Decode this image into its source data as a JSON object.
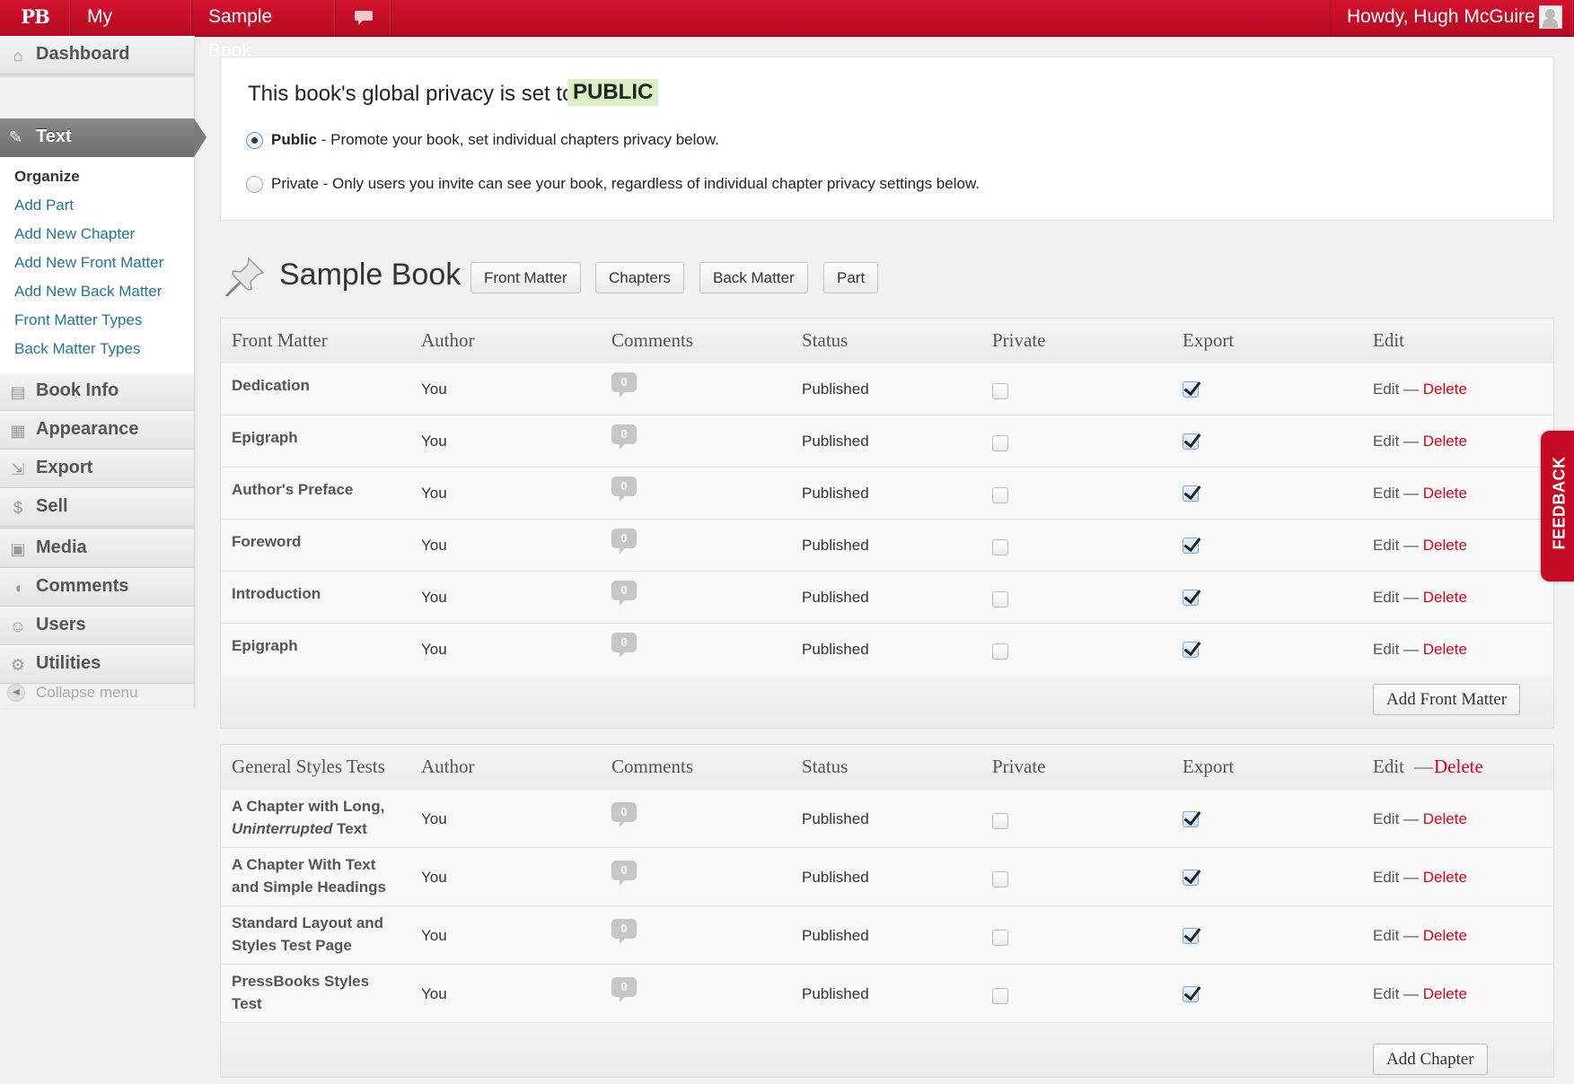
{
  "adminbar": {
    "logo": "PB",
    "catalog": "My Catalog",
    "book": "Sample Book",
    "comments_icon": "speech-bubble-icon",
    "howdy": "Howdy, Hugh McGuire"
  },
  "sidebar": {
    "dashboard": "Dashboard",
    "text": "Text",
    "submenu": [
      "Organize",
      "Add Part",
      "Add New Chapter",
      "Add New Front Matter",
      "Add New Back Matter",
      "Front Matter Types",
      "Back Matter Types"
    ],
    "book_info": "Book Info",
    "appearance": "Appearance",
    "export": "Export",
    "sell": "Sell",
    "media": "Media",
    "comments": "Comments",
    "users": "Users",
    "utilities": "Utilities",
    "collapse": "Collapse menu"
  },
  "privacy": {
    "title": "This book's global privacy is set to",
    "status": "PUBLIC",
    "public_label": "Public",
    "public_desc": " - Promote your book, set individual chapters privacy below.",
    "private_desc": "Private - Only users you invite can see your book, regardless of individual chapter privacy settings below.",
    "selected": "public"
  },
  "heading": {
    "title": "Sample Book",
    "buttons": [
      "Front Matter",
      "Chapters",
      "Back Matter",
      "Part"
    ]
  },
  "front_matter": {
    "headers": [
      "Front Matter",
      "Author",
      "Comments",
      "Status",
      "Private",
      "Export",
      "Edit"
    ],
    "rows": [
      {
        "title": "Dedication",
        "author": "You",
        "comments": "0",
        "status": "Published",
        "private": false,
        "export": true
      },
      {
        "title": "Epigraph",
        "author": "You",
        "comments": "0",
        "status": "Published",
        "private": false,
        "export": true
      },
      {
        "title": "Author's Preface",
        "author": "You",
        "comments": "0",
        "status": "Published",
        "private": false,
        "export": true
      },
      {
        "title": "Foreword",
        "author": "You",
        "comments": "0",
        "status": "Published",
        "private": false,
        "export": true
      },
      {
        "title": "Introduction",
        "author": "You",
        "comments": "0",
        "status": "Published",
        "private": false,
        "export": true
      },
      {
        "title": "Epigraph",
        "author": "You",
        "comments": "0",
        "status": "Published",
        "private": false,
        "export": true
      }
    ],
    "edit_label": "Edit",
    "dash": "—",
    "delete_label": "Delete",
    "add_button": "Add Front Matter"
  },
  "part": {
    "headers": [
      "General Styles Tests",
      "Author",
      "Comments",
      "Status",
      "Private",
      "Export",
      "Edit"
    ],
    "header_dash": "—",
    "header_delete": "Delete",
    "rows": [
      {
        "title_line1": "A Chapter with Long,",
        "title_line2_em": "Uninterrupted",
        "title_line2_rest": " Text",
        "author": "You",
        "comments": "0",
        "status": "Published",
        "private": false,
        "export": true
      },
      {
        "title_line1": "A Chapter With Text",
        "title_line2_em": "",
        "title_line2_rest": "and Simple Headings",
        "author": "You",
        "comments": "0",
        "status": "Published",
        "private": false,
        "export": true
      },
      {
        "title_line1": "Standard Layout and",
        "title_line2_em": "",
        "title_line2_rest": "Styles Test Page",
        "author": "You",
        "comments": "0",
        "status": "Published",
        "private": false,
        "export": true
      },
      {
        "title_line1": "PressBooks Styles",
        "title_line2_em": "",
        "title_line2_rest": "Test",
        "author": "You",
        "comments": "0",
        "status": "Published",
        "private": false,
        "export": true
      }
    ],
    "edit_label": "Edit",
    "dash": "—",
    "delete_label": "Delete",
    "add_button": "Add Chapter"
  },
  "feedback": "FEEDBACK",
  "colors": {
    "brand_red": "#c40a24",
    "delete_red": "#e0001b",
    "public_highlight": "#d8f0c4"
  }
}
